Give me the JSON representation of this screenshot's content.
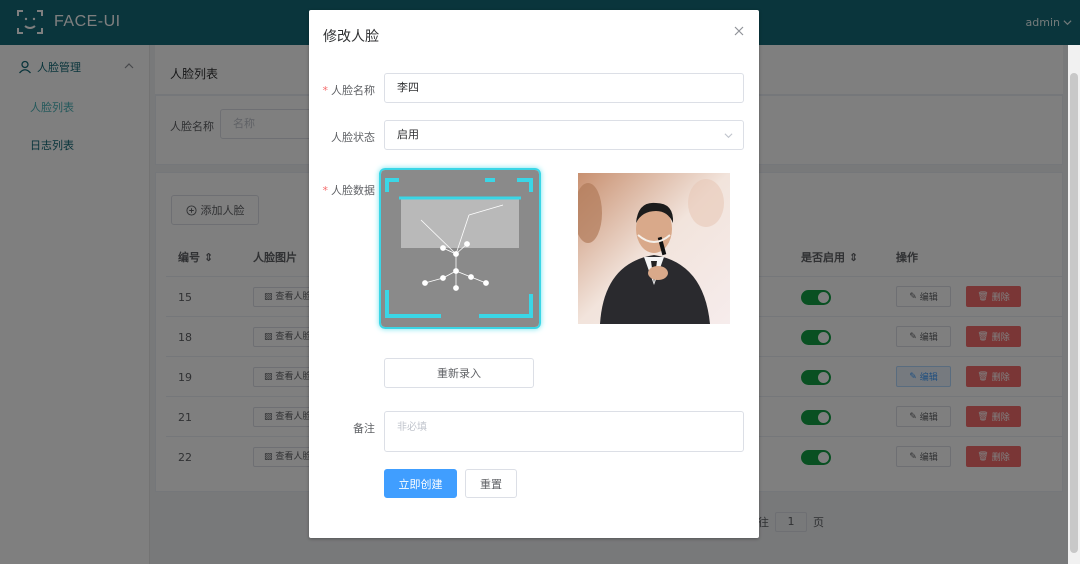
{
  "header": {
    "app_title": "FACE-UI",
    "user": "admin"
  },
  "sidebar": {
    "group_label": "人脸管理",
    "items": [
      {
        "label": "人脸列表"
      },
      {
        "label": "日志列表"
      }
    ]
  },
  "page": {
    "title": "人脸列表",
    "filter": {
      "label": "人脸名称",
      "placeholder": "名称"
    },
    "add_button": "添加人脸",
    "columns": {
      "id": "编号",
      "image": "人脸图片",
      "enabled": "是否启用",
      "actions": "操作"
    },
    "rows": [
      {
        "id": "15",
        "view": "查看人脸",
        "edit": "编辑",
        "delete": "删除"
      },
      {
        "id": "18",
        "view": "查看人脸",
        "edit": "编辑",
        "delete": "删除"
      },
      {
        "id": "19",
        "view": "查看人脸",
        "edit": "编辑",
        "delete": "删除"
      },
      {
        "id": "21",
        "view": "查看人脸",
        "edit": "编辑",
        "delete": "删除"
      },
      {
        "id": "22",
        "view": "查看人脸",
        "edit": "编辑",
        "delete": "删除"
      }
    ],
    "pager": {
      "prefix": "往",
      "page": "1",
      "suffix": "页"
    }
  },
  "dialog": {
    "title": "修改人脸",
    "fields": {
      "name_label": "人脸名称",
      "name_value": "李四",
      "status_label": "人脸状态",
      "status_value": "启用",
      "data_label": "人脸数据",
      "remark_label": "备注",
      "remark_placeholder": "非必填"
    },
    "re_record_button": "重新录入",
    "create_button": "立即创建",
    "reset_button": "重置"
  },
  "colors": {
    "header": "#156a78",
    "primary": "#409eff",
    "danger": "#f56c6c",
    "switch": "#13a044",
    "frame": "#3ad6e6"
  }
}
